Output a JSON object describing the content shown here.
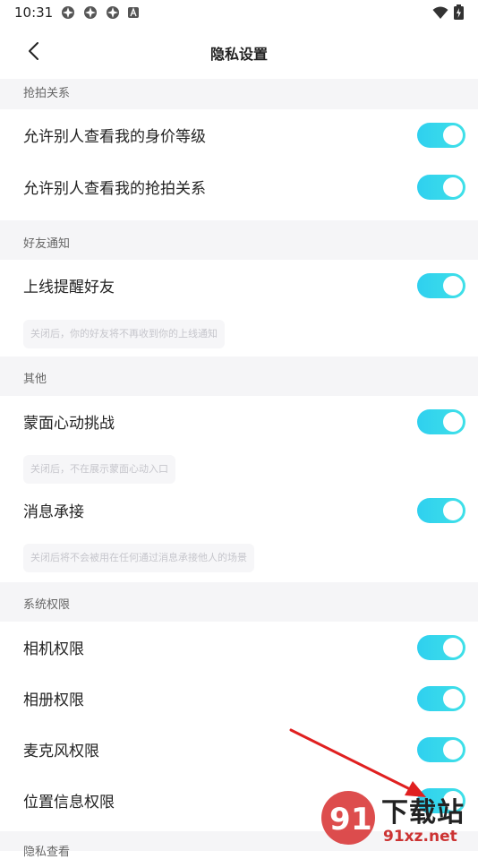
{
  "status_bar": {
    "time": "10:31"
  },
  "nav": {
    "title": "隐私设置"
  },
  "sections": [
    {
      "header": "抢拍关系"
    },
    {
      "header": "好友通知"
    },
    {
      "header": "其他"
    },
    {
      "header": "系统权限"
    },
    {
      "header": "隐私查看"
    }
  ],
  "rows": [
    {
      "label": "允许别人查看我的身价等级",
      "on": true
    },
    {
      "label": "允许别人查看我的抢拍关系",
      "on": true
    },
    {
      "label": "上线提醒好友",
      "on": true
    },
    {
      "label": "蒙面心动挑战",
      "on": true
    },
    {
      "label": "消息承接",
      "on": true
    },
    {
      "label": "相机权限",
      "on": true
    },
    {
      "label": "相册权限",
      "on": true
    },
    {
      "label": "麦克风权限",
      "on": true
    },
    {
      "label": "位置信息权限",
      "on": true
    }
  ],
  "notes": [
    "关闭后，你的好友将不再收到你的上线通知",
    "关闭后，不在展示蒙面心动入口",
    "关闭后将不会被用在任何通过消息承接他人的场景"
  ],
  "watermark": {
    "main": "下载站",
    "sub": "91xz.net"
  },
  "colors": {
    "toggle_on": "#2fd0ef",
    "section_bg": "#f5f5f7",
    "arrow": "#e02020"
  }
}
